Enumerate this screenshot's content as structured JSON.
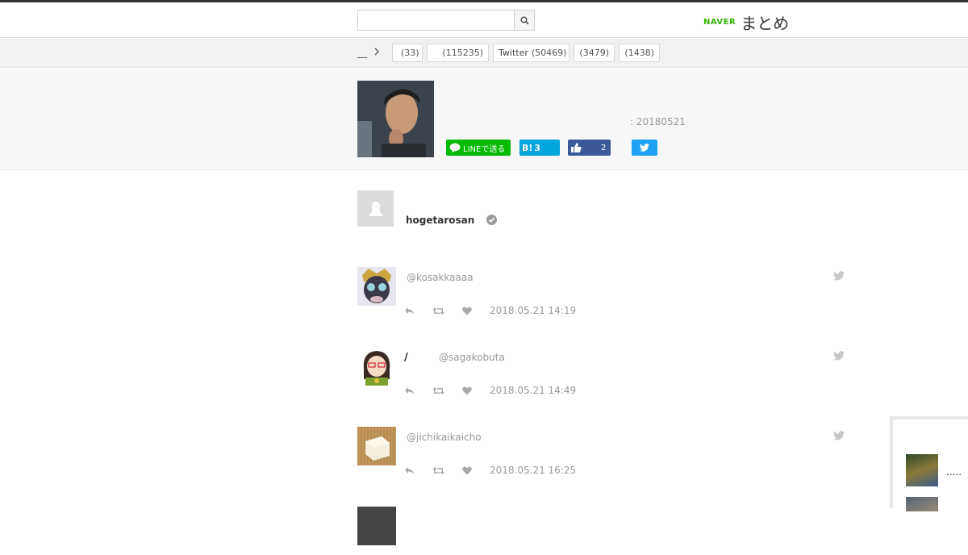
{
  "header": {
    "search_placeholder": "",
    "logo_naver": "NAVER",
    "logo_matome": "まとめ"
  },
  "categories": {
    "breadcrumb": "__",
    "tags": [
      {
        "name": "",
        "count": "(33)"
      },
      {
        "name": "",
        "count": "(115235)"
      },
      {
        "name": "Twitter",
        "count": "(50469)"
      },
      {
        "name": "",
        "count": "(3479)"
      },
      {
        "name": "",
        "count": "(1438)"
      }
    ]
  },
  "hero": {
    "date": ": 20180521",
    "share": {
      "line_label": "LINEで送る",
      "hatena_label": "B!",
      "hatena_count": "3",
      "fb_count": "2"
    }
  },
  "author": {
    "name": "hogetarosan"
  },
  "tweets": [
    {
      "display_name": "",
      "handle": "@kosakkaaaa",
      "time": "2018.05.21 14:19"
    },
    {
      "display_name": "/",
      "handle": "@sagakobuta",
      "time": "2018.05.21 14:49"
    },
    {
      "display_name": "",
      "handle": "@jichikaikaicho",
      "time": "2018.05.21 16:25"
    }
  ],
  "side_panel": {
    "ellipsis": "....."
  },
  "colors": {
    "naver_green": "#2db400",
    "line_green": "#00b900",
    "hatena_blue": "#00a4de",
    "facebook_blue": "#3b5998",
    "twitter_blue": "#1da1f2"
  }
}
